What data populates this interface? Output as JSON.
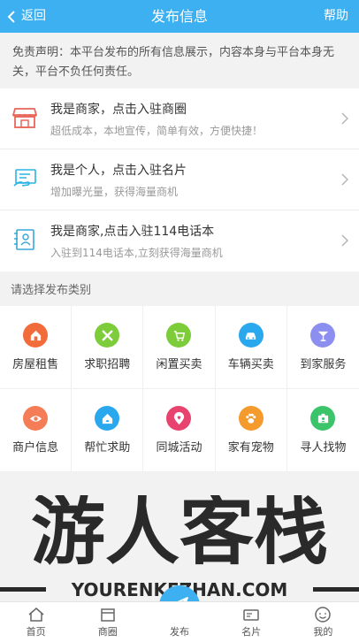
{
  "header": {
    "back_label": "返回",
    "title": "发布信息",
    "help_label": "帮助"
  },
  "disclaimer": {
    "text": "免责声明：本平台发布的所有信息展示，内容本身与平台本身无关，平台不负任何责任。"
  },
  "entries": [
    {
      "icon": "storefront-icon",
      "title": "我是商家，点击入驻商圈",
      "subtitle": "超低成本，本地宣传，简单有效，方便快捷！"
    },
    {
      "icon": "business-card-icon",
      "title": "我是个人，点击入驻名片",
      "subtitle": "增加曝光量，获得海量商机"
    },
    {
      "icon": "phone-directory-icon",
      "title": "我是商家,点击入驻114电话本",
      "subtitle": "入驻到114电话本,立刻获得海量商机"
    }
  ],
  "category_label": "请选择发布类别",
  "categories": [
    {
      "label": "房屋租售",
      "icon": "house-icon",
      "color": "#f26b3a"
    },
    {
      "label": "求职招聘",
      "icon": "wrench-icon",
      "color": "#7dcc3a"
    },
    {
      "label": "闲置买卖",
      "icon": "cart-icon",
      "color": "#7dcc3a"
    },
    {
      "label": "车辆买卖",
      "icon": "car-icon",
      "color": "#2aa8ee"
    },
    {
      "label": "到家服务",
      "icon": "cocktail-icon",
      "color": "#8c8ff0"
    },
    {
      "label": "商户信息",
      "icon": "eye-icon",
      "color": "#f47c57"
    },
    {
      "label": "帮忙求助",
      "icon": "home-help-icon",
      "color": "#2aa8ee"
    },
    {
      "label": "同城活动",
      "icon": "location-heart-icon",
      "color": "#e8436e"
    },
    {
      "label": "家有宠物",
      "icon": "paw-icon",
      "color": "#f59a2c"
    },
    {
      "label": "寻人找物",
      "icon": "id-card-icon",
      "color": "#3cc46a"
    }
  ],
  "watermark": {
    "text": "游人客栈",
    "url": "YOURENKEZHAN.COM"
  },
  "tabbar": [
    {
      "label": "首页",
      "icon": "home-icon"
    },
    {
      "label": "商圈",
      "icon": "shop-icon"
    },
    {
      "label": "发布",
      "icon": "paper-plane-icon"
    },
    {
      "label": "名片",
      "icon": "card-icon"
    },
    {
      "label": "我的",
      "icon": "user-icon"
    }
  ],
  "colors": {
    "primary": "#3cb0f0",
    "background": "#f2f2f2"
  }
}
